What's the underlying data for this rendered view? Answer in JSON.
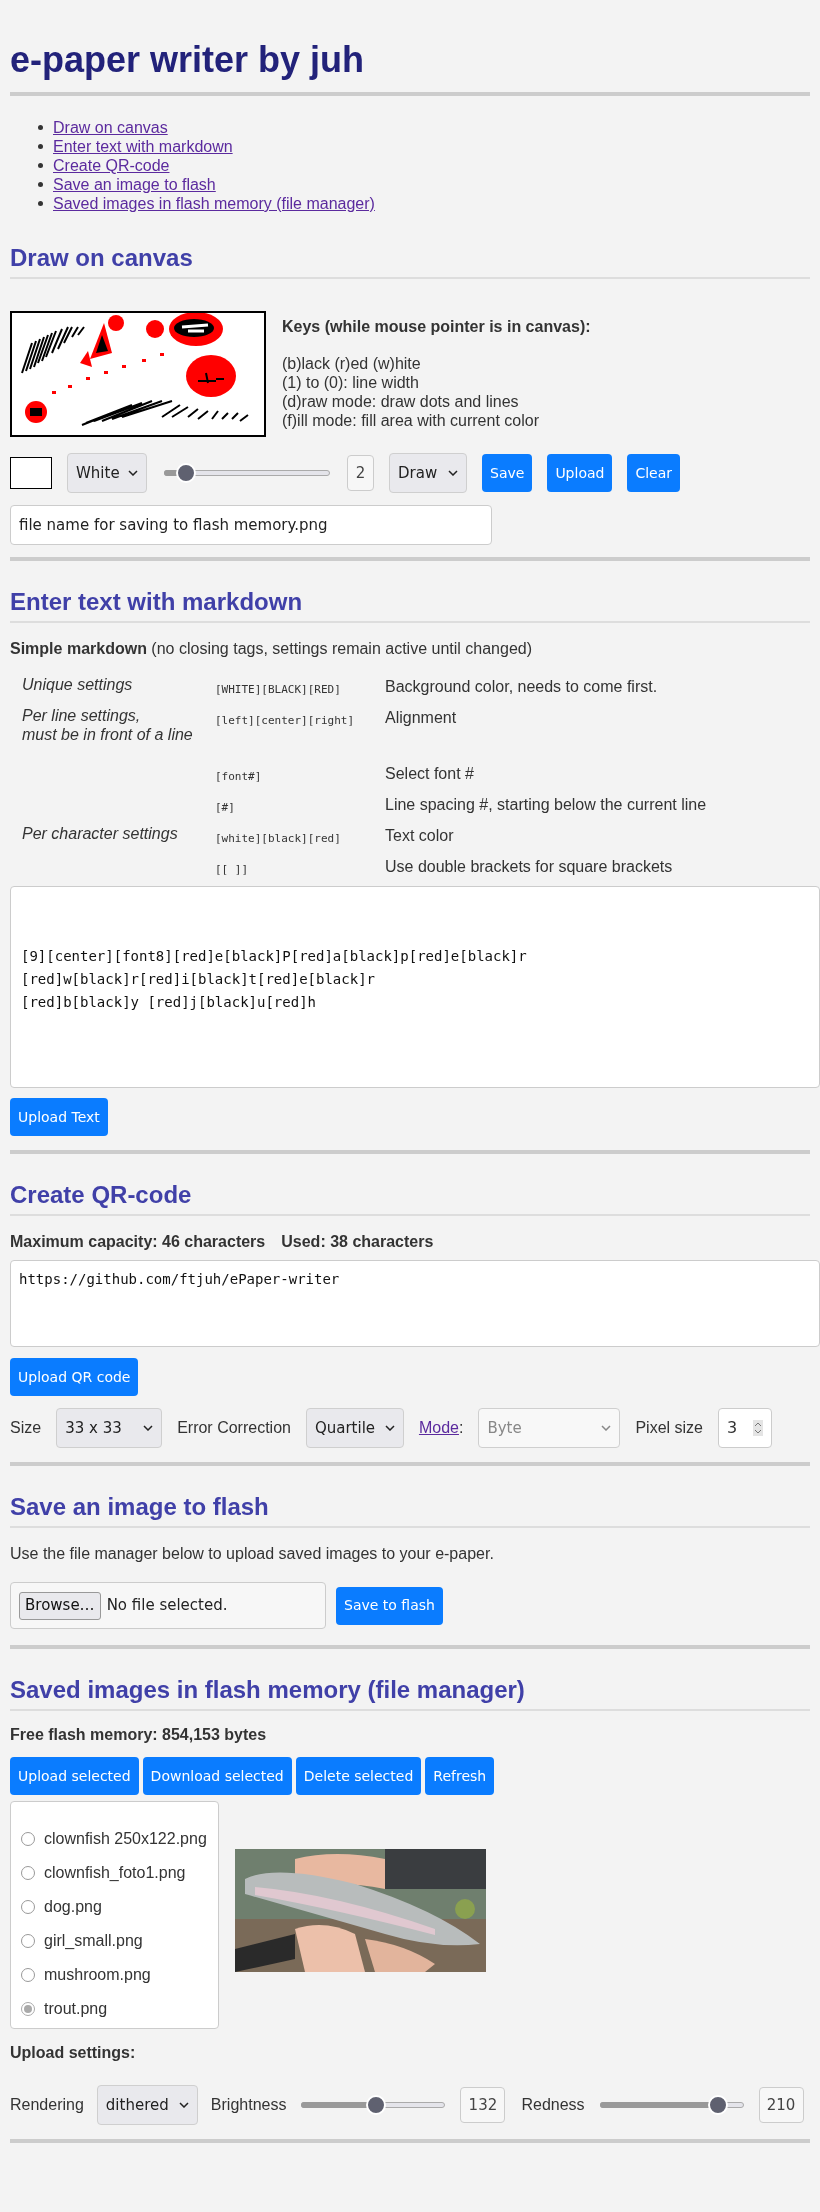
{
  "title": "e-paper writer by juh",
  "toc": [
    "Draw on canvas",
    "Enter text with markdown",
    "Create QR-code",
    "Save an image to flash",
    "Saved images in flash memory (file manager)"
  ],
  "draw": {
    "heading": "Draw on canvas",
    "keys_title": "Keys (while mouse pointer is in canvas):",
    "keys": [
      "(b)lack (r)ed (w)hite",
      "(1) to (0): line width",
      "(d)raw mode: draw dots and lines",
      "(f)ill mode: fill area with current color"
    ],
    "color_select": "White",
    "line_width": {
      "level": 0.13,
      "reading": "2"
    },
    "mode_select": "Draw",
    "buttons": [
      "Save",
      "Upload",
      "Clear"
    ],
    "filename": {
      "value": "file name for saving to flash memory.png"
    }
  },
  "markdown": {
    "heading": "Enter text with markdown",
    "intro": "**Simple markdown** (no closing tags, settings remain active until changed)",
    "rows": [
      {
        "category": "Unique settings",
        "code": "[WHITE][BLACK][RED]",
        "description": "Background color, needs to come first."
      },
      {
        "category": "Per line settings,\nmust be in front of a line",
        "code": "[left][center][right]",
        "description": "Alignment"
      },
      {
        "code": "[font#]",
        "description": "Select font #"
      },
      {
        "code": "[#]",
        "description": "Line spacing #, starting below the current line"
      },
      {
        "category": "Per character settings",
        "code": "[white][black][red]",
        "description": "Text color"
      },
      {
        "code": "[[ ]]",
        "description": "Use double brackets for square brackets"
      }
    ],
    "text": {
      "value": "[9][center][font8][red]e[black]P[red]a[black]p[red]e[black]r\n[red]w[black]r[red]i[black]t[red]e[black]r\n[red]b[black]y [red]j[black]u[red]h"
    },
    "button": "Upload Text"
  },
  "qr": {
    "heading": "Create QR-code",
    "capacity": "Maximum capacity: 46 characters",
    "used": "Used: 38 characters",
    "text": {
      "value": "https://github.com/ftjuh/ePaper-writer"
    },
    "button": "Upload QR code",
    "size_label": "Size",
    "size_select": "33 x 33",
    "ec_label": "Error Correction",
    "ec_select": "Quartile",
    "mode_link": "Mode",
    "mode_suffix": ":",
    "mode_select": {
      "value": "Byte",
      "disabled": true
    },
    "pixel_label": "Pixel size",
    "pixel_size": "3"
  },
  "save": {
    "heading": "Save an image to flash",
    "note": "Use the file manager below to upload saved images to your e-paper.",
    "browse_button": "Browse…",
    "file_status": "No file selected.",
    "button": "Save to flash"
  },
  "files": {
    "heading": "Saved images in flash memory (file manager)",
    "free": "Free flash memory: 854,153 bytes",
    "buttons": [
      "Upload selected",
      "Download selected",
      "Delete selected",
      "Refresh"
    ],
    "items": [
      {
        "name": "clownfish 250x122.png",
        "selected": false
      },
      {
        "name": "clownfish_foto1.png",
        "selected": false
      },
      {
        "name": "dog.png",
        "selected": false
      },
      {
        "name": "girl_small.png",
        "selected": false
      },
      {
        "name": "mushroom.png",
        "selected": false
      },
      {
        "name": "trout.png",
        "selected": true
      }
    ],
    "preview": {
      "kind": "picture"
    },
    "settings_title": "Upload settings:",
    "rendering_label": "Rendering",
    "rendering_select": "dithered",
    "brightness": {
      "label": "Brightness",
      "level": 0.52,
      "reading": "132"
    },
    "redness": {
      "label": "Redness",
      "level": 0.82,
      "reading": "210"
    }
  }
}
